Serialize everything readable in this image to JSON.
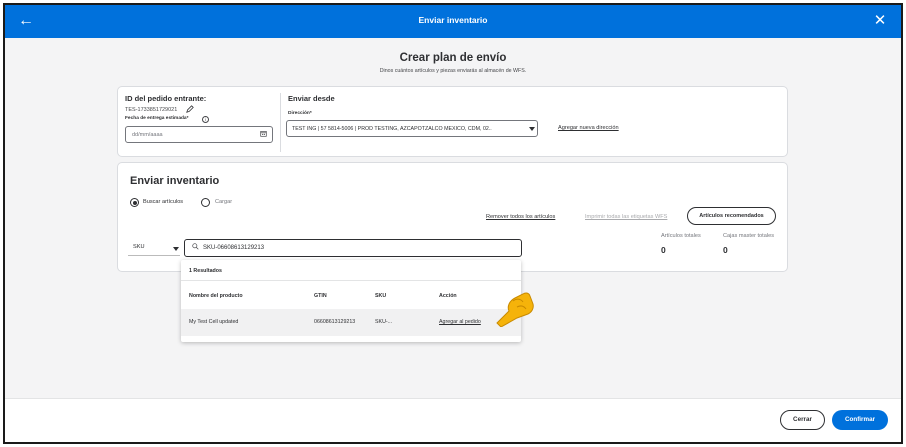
{
  "modal": {
    "title": "Enviar inventario",
    "back_icon": "←",
    "close_icon": "✕"
  },
  "header": {
    "title": "Crear plan de envío",
    "subtitle": "Dinos cuántos artículos y piezas enviarás al almacén de WFS."
  },
  "order": {
    "id_label": "ID del pedido entrante:",
    "id_value": "TES-1733851729021",
    "date_label": "Fecha de entrega estimada*",
    "date_placeholder": "dd/mm/aaaa"
  },
  "ship_from": {
    "title": "Enviar desde",
    "address_label": "Dirección*",
    "address_value": "TEST ING | 57 5814-5006 | PROD TESTING, AZCAPOTZALCO MEXICO, CDM, 02..",
    "add_link": "Agregar nueva dirección"
  },
  "inventory": {
    "title": "Enviar inventario",
    "radio_search": "Buscar artículos",
    "radio_upload": "Cargar",
    "remove_all": "Remover todos los artículos",
    "print_labels": "Imprimir todas las etiquetas WFS",
    "recommended": "Artículos recomendados",
    "search_type": "SKU",
    "search_value": "SKU-06608613129213",
    "total_items_label": "Artículos totales",
    "total_items_value": "0",
    "master_boxes_label": "Cajas master totales",
    "master_boxes_value": "0"
  },
  "results": {
    "count": "1 Resultados",
    "columns": [
      "Nombre del producto",
      "GTIN",
      "SKU",
      "Acción"
    ],
    "rows": [
      {
        "name": "My Test Cell updated",
        "gtin": "06608613129213",
        "sku": "SKU-...",
        "action": "Agregar al pedido"
      }
    ]
  },
  "footer": {
    "cancel": "Cerrar",
    "confirm": "Confirmar"
  },
  "colors": {
    "brand_blue": "#0071dc",
    "hand_yellow": "#f5b30a"
  },
  "icons": [
    "back-arrow-icon",
    "close-icon",
    "pencil-icon",
    "info-icon",
    "calendar-icon",
    "chevron-down-icon",
    "search-icon",
    "pointing-hand-icon"
  ]
}
